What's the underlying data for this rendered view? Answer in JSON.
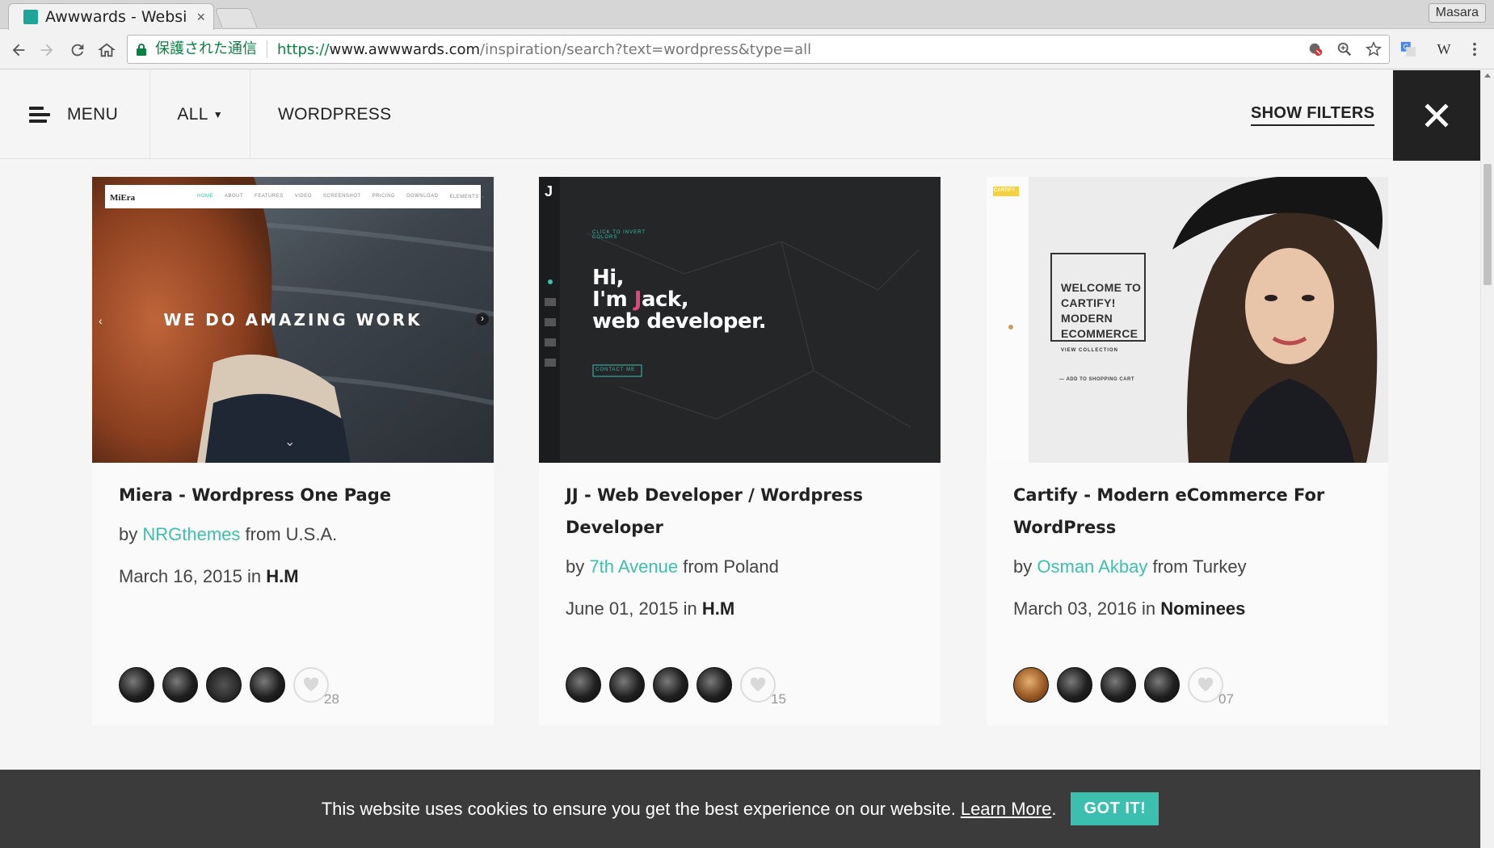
{
  "browser": {
    "tab_title": "Awwwards - Websi",
    "tab_close": "×",
    "profile": "Masara",
    "secure_text": "保護された通信",
    "url_scheme": "https://",
    "url_host": "www.awwwards.com",
    "url_path": "/inspiration/search?text=wordpress&type=all",
    "ext_w": "W"
  },
  "header": {
    "menu_label": "MENU",
    "all_label": "ALL",
    "search_term": "WORDPRESS",
    "filters_label": "SHOW FILTERS"
  },
  "cards": [
    {
      "title": "Miera - Wordpress One Page",
      "by": "by",
      "author": "NRGthemes",
      "from": "from U.S.A.",
      "date": "March 16, 2015",
      "in": "in",
      "award": "H.M",
      "votes": "28",
      "thumb_nav": [
        "HOME",
        "ABOUT",
        "FEATURES",
        "VIDEO",
        "SCREENSHOT",
        "PRICING",
        "DOWNLOAD",
        "ELEMENTS ⌄"
      ],
      "thumb_logo": "MiEra",
      "thumb_headline": "WE DO AMAZING WORK"
    },
    {
      "title": "JJ - Web Developer / Wordpress Developer",
      "by": "by",
      "author": "7th Avenue",
      "from": "from Poland",
      "date": "June 01, 2015",
      "in": "in",
      "award": "H.M",
      "votes": "15",
      "thumb_logo": "J",
      "thumb_line1": "Hi,",
      "thumb_line2a": "I'm ",
      "thumb_line2b": "J",
      "thumb_line2c": "ack,",
      "thumb_line3": "web developer.",
      "thumb_click": "CLICK TO INVERT COLORS",
      "thumb_contact": "CONTACT ME"
    },
    {
      "title": "Cartify - Modern eCommerce For WordPress",
      "by": "by",
      "author": "Osman Akbay",
      "from": "from Turkey",
      "date": "March 03, 2016",
      "in": "in",
      "award": "Nominees",
      "votes": "07",
      "thumb_logo": "CARTIFY",
      "thumb_box": [
        "WELCOME TO",
        "CARTIFY!",
        "MODERN",
        "ECOMMERCE"
      ],
      "thumb_box_sub": "VIEW COLLECTION",
      "thumb_add": "— ADD TO SHOPPING CART"
    }
  ],
  "cookie": {
    "text": "This website uses cookies to ensure you get the best experience on our website.",
    "link": "Learn More",
    "dot": ".",
    "button": "GOT IT!"
  },
  "colors": {
    "accent": "#3dbfb0",
    "dark": "#222222",
    "cookie_bg": "#3b3b3b"
  }
}
